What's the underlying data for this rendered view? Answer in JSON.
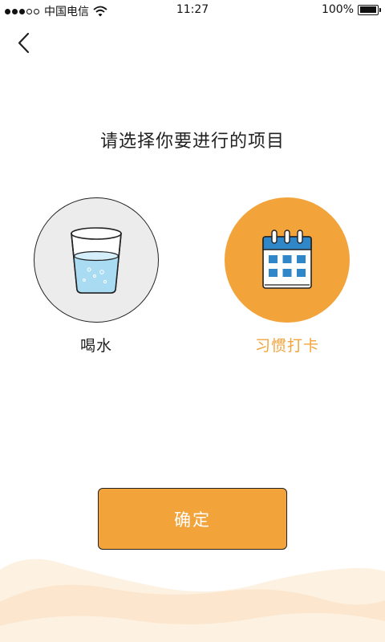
{
  "status_bar": {
    "carrier": "中国电信",
    "time": "11:27",
    "battery": "100%",
    "battery_level": 1.0,
    "signal_strength": 3
  },
  "header": {
    "back_icon": "chevron-left-icon"
  },
  "main": {
    "title": "请选择你要进行的项目",
    "options": [
      {
        "label": "喝水",
        "icon": "water-glass-icon",
        "selected": false
      },
      {
        "label": "习惯打卡",
        "icon": "calendar-icon",
        "selected": true
      }
    ]
  },
  "footer": {
    "confirm_label": "确定"
  },
  "colors": {
    "accent": "#f2a33a",
    "calendar_blue": "#2f87c9",
    "wave_light": "#fdf1e2",
    "wave_mid": "#fbe4c8"
  }
}
